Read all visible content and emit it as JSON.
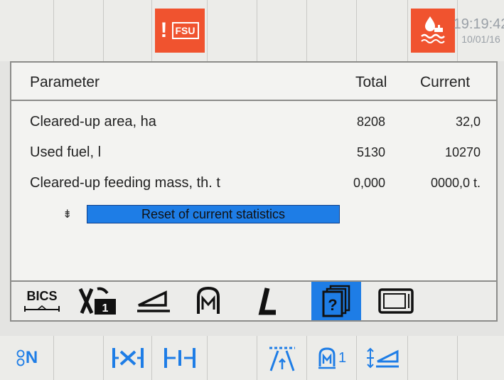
{
  "status_bar": {
    "warning_mark": "!",
    "warning_code": "FSU",
    "warning_color": "#f0532f",
    "hydraulic_icon": "hydraulic-oil-temperature-icon",
    "time": "19:19:42",
    "date": "10/01/16"
  },
  "table": {
    "headers": {
      "parameter": "Parameter",
      "total": "Total",
      "current": "Current"
    },
    "rows": [
      {
        "label": "Cleared-up area, ha",
        "total": "8208",
        "current": "32,0"
      },
      {
        "label": "Used fuel, l",
        "total": "5130",
        "current": "10270"
      },
      {
        "label": "Cleared-up feeding mass, th. t",
        "total": "0,000",
        "current": "0000,0 t."
      }
    ],
    "reset_label": "Reset of current statistics"
  },
  "function_bar": {
    "bics_label": "BICS",
    "icons": [
      "bics-icon",
      "counter-icon",
      "header-height-icon",
      "engine-menu-icon",
      "l-mode-icon",
      "help-info-icon",
      "display-screen-icon"
    ],
    "selected": "help-info-icon",
    "accent": "#1e7de6"
  },
  "bottom_bar": {
    "neutral_label": "N",
    "m_index": "1",
    "icons": [
      "neutral-gear-icon",
      "reel-position-icon",
      "reel-speed-icon",
      "unloading-auger-icon",
      "engine-mode-1-icon",
      "header-adjust-icon"
    ]
  }
}
